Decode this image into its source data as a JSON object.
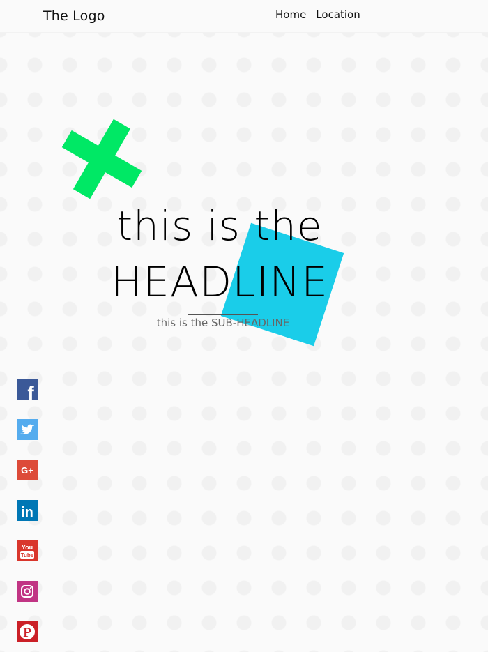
{
  "header": {
    "logo_text": "The Logo",
    "nav": [
      {
        "label": "Home"
      },
      {
        "label": "Location"
      }
    ]
  },
  "hero": {
    "headline_line1": "this is the",
    "headline_line2": "HEADLINE",
    "subheadline": "this is the SUB-HEADLINE"
  },
  "decorations": {
    "cross_color": "#00e865",
    "square_color": "#1acde9"
  },
  "social": [
    {
      "name": "facebook",
      "icon": "facebook-icon",
      "color": "#3b5998",
      "glyph": "f"
    },
    {
      "name": "twitter",
      "icon": "twitter-icon",
      "color": "#55acee"
    },
    {
      "name": "google-plus",
      "icon": "google-plus-icon",
      "color": "#dd4b39",
      "glyph": "G+"
    },
    {
      "name": "linkedin",
      "icon": "linkedin-icon",
      "color": "#0077b5",
      "glyph": "in"
    },
    {
      "name": "youtube",
      "icon": "youtube-icon",
      "color": "#d9362c",
      "glyph_top": "You",
      "glyph_bottom": "Tube"
    },
    {
      "name": "instagram",
      "icon": "instagram-icon",
      "color": "#c13584"
    },
    {
      "name": "pinterest",
      "icon": "pinterest-icon",
      "color": "#cb2027",
      "glyph": "P"
    }
  ]
}
